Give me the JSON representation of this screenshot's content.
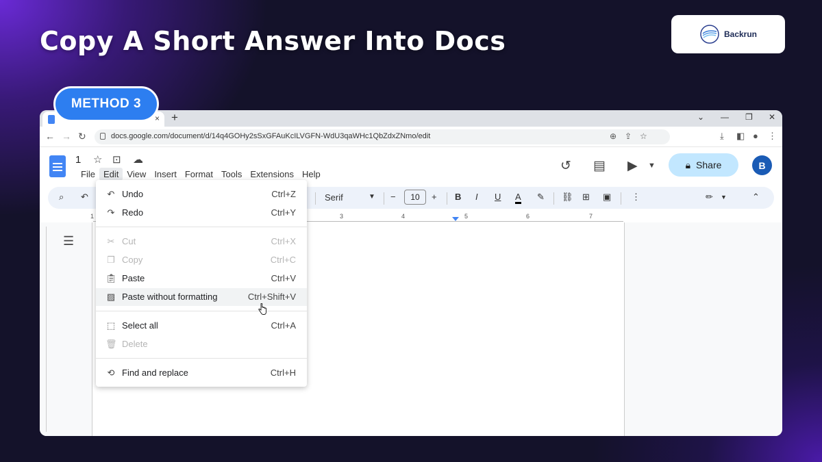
{
  "headline": "Copy A Short Answer Into Docs",
  "brand": {
    "name": "Backrun",
    "logo_icon": "wave-logo-icon"
  },
  "method_badge": "METHOD 3",
  "browser": {
    "tab": {
      "close": "×",
      "new_tab": "+"
    },
    "window_controls": [
      "⌄",
      "—",
      "❐",
      "✕"
    ],
    "url": "docs.google.com/document/d/14q4GOHy2sSxGFAuKcILVGFN-WdU3qaWHc1QbZdxZNmo/edit"
  },
  "docs": {
    "title": "1",
    "menus": [
      "File",
      "Edit",
      "View",
      "Insert",
      "Format",
      "Tools",
      "Extensions",
      "Help"
    ],
    "active_menu": "Edit",
    "share_label": "Share",
    "avatar_initial": "B",
    "toolbar": {
      "font": "Serif",
      "font_size": "10"
    },
    "ruler_numbers": [
      "1",
      "3",
      "4",
      "5",
      "6",
      "7"
    ]
  },
  "edit_menu": {
    "items": [
      {
        "label": "Undo",
        "shortcut": "Ctrl+Z",
        "icon": "undo-icon",
        "disabled": false
      },
      {
        "label": "Redo",
        "shortcut": "Ctrl+Y",
        "icon": "redo-icon",
        "disabled": false
      },
      {
        "label": "Cut",
        "shortcut": "Ctrl+X",
        "icon": "scissors-icon",
        "disabled": true
      },
      {
        "label": "Copy",
        "shortcut": "Ctrl+C",
        "icon": "copy-icon",
        "disabled": true
      },
      {
        "label": "Paste",
        "shortcut": "Ctrl+V",
        "icon": "clipboard-icon",
        "disabled": false
      },
      {
        "label": "Paste without formatting",
        "shortcut": "Ctrl+Shift+V",
        "icon": "clipboard-plain-icon",
        "disabled": false,
        "hovered": true
      },
      {
        "label": "Select all",
        "shortcut": "Ctrl+A",
        "icon": "select-all-icon",
        "disabled": false
      },
      {
        "label": "Delete",
        "shortcut": "",
        "icon": "trash-icon",
        "disabled": true
      },
      {
        "label": "Find and replace",
        "shortcut": "Ctrl+H",
        "icon": "find-replace-icon",
        "disabled": false
      }
    ]
  },
  "colors": {
    "accent": "#2d7ef0",
    "docs_blue": "#4285f4",
    "share_bg": "#c2e7ff"
  }
}
